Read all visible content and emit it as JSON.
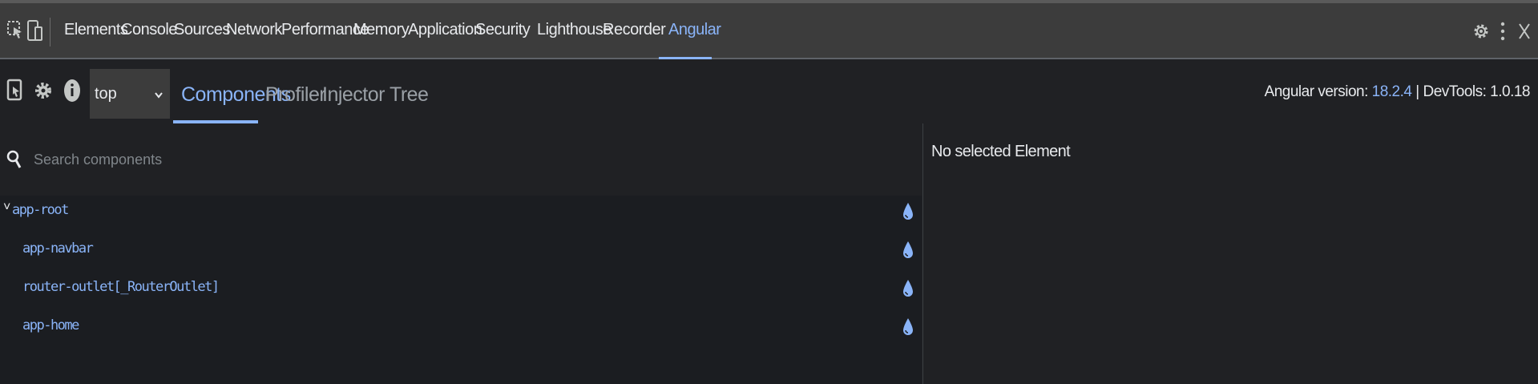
{
  "devtools": {
    "tabs": [
      {
        "label": "Elements"
      },
      {
        "label": "Console"
      },
      {
        "label": "Sources"
      },
      {
        "label": "Network"
      },
      {
        "label": "Performance"
      },
      {
        "label": "Memory"
      },
      {
        "label": "Application"
      },
      {
        "label": "Security"
      },
      {
        "label": "Lighthouse"
      },
      {
        "label": "Recorder"
      },
      {
        "label": "Angular"
      }
    ],
    "active_tab": "Angular",
    "right_icons": [
      "settings-gear-icon",
      "more-vertical-icon",
      "close-icon"
    ]
  },
  "angular": {
    "frame_select": {
      "value": "top"
    },
    "tabs": [
      {
        "label": "Components"
      },
      {
        "label": "Profiler"
      },
      {
        "label": "Injector Tree"
      }
    ],
    "active_tab": "Components",
    "version_label": "Angular version:",
    "angular_version": "18.2.4",
    "version_sep": "|",
    "devtools_version": "DevTools: 1.0.18"
  },
  "components": {
    "search": {
      "placeholder": "Search components",
      "value": ""
    },
    "tree": [
      {
        "label": "app-root",
        "expanded": true,
        "caret": "˅"
      },
      {
        "label": "app-navbar"
      },
      {
        "label": "router-outlet[_RouterOutlet]"
      },
      {
        "label": "app-home"
      }
    ]
  },
  "details": {
    "empty_text": "No selected Element"
  },
  "colors": {
    "accent": "#8ab4f8",
    "background": "#202124",
    "toolbar": "#3c3c3c"
  }
}
